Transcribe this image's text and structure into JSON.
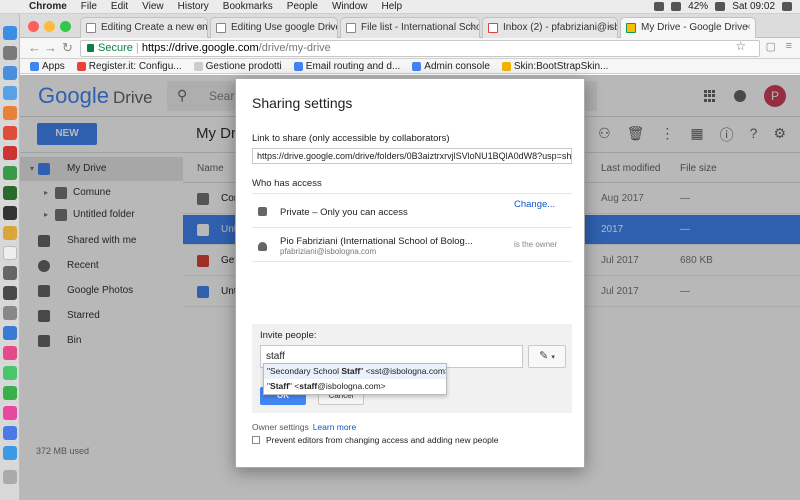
{
  "menubar": {
    "app": "Chrome",
    "items": [
      "File",
      "Edit",
      "View",
      "History",
      "Bookmarks",
      "People",
      "Window",
      "Help"
    ],
    "battery": "42%",
    "clock": "Sat 09:02"
  },
  "tabs": [
    {
      "title": "Editing Create a new one for"
    },
    {
      "title": "Editing Use google Drive for"
    },
    {
      "title": "File list - International School"
    },
    {
      "title": "Inbox (2) - pfabriziani@isbol"
    },
    {
      "title": "My Drive - Google Drive"
    }
  ],
  "omnibox": {
    "secure": "Secure",
    "url_host": "https://drive.google.com",
    "url_path": "/drive/my-drive"
  },
  "bookmarks": [
    {
      "label": "Apps",
      "color": "#4285f4"
    },
    {
      "label": "Register.it: Configu...",
      "color": "#ea4335"
    },
    {
      "label": "Gestione prodotti",
      "color": "#999999"
    },
    {
      "label": "Email routing and d...",
      "color": "#4285f4"
    },
    {
      "label": "Admin console",
      "color": "#4285f4"
    },
    {
      "label": "Skin:BootStrapSkin...",
      "color": "#f4b400"
    }
  ],
  "drive": {
    "logo": "Google",
    "logo_product": "Drive",
    "search_placeholder": "Search",
    "avatar_letter": "P",
    "new_button": "NEW",
    "title": "My Drive",
    "sidebar": [
      {
        "label": "My Drive"
      },
      {
        "label": "Comune"
      },
      {
        "label": "Untitled folder"
      },
      {
        "label": "Shared with me"
      },
      {
        "label": "Recent"
      },
      {
        "label": "Google Photos"
      },
      {
        "label": "Starred"
      },
      {
        "label": "Bin"
      }
    ],
    "usage": "372 MB used",
    "columns": {
      "name": "Name",
      "modified": "Last modified",
      "size": "File size"
    },
    "files": [
      {
        "name": "Comune",
        "modified": "Aug 2017",
        "size": "—",
        "color": "#757575"
      },
      {
        "name": "Untitled folder",
        "modified": "2017",
        "size": "—",
        "color": "#757575"
      },
      {
        "name": "Getting started",
        "modified": "Jul 2017",
        "size": "680 KB",
        "color": "#db4437"
      },
      {
        "name": "Untitled document",
        "modified": "Jul 2017",
        "size": "—",
        "color": "#4285f4"
      }
    ]
  },
  "dialog": {
    "title": "Sharing settings",
    "link_label": "Link to share (only accessible by collaborators)",
    "link_value": "https://drive.google.com/drive/folders/0B3aiztrxrvjlSVloNU1BQlA0dW8?usp=sharing",
    "who_label": "Who has access",
    "privacy": "Private – Only you can access",
    "change": "Change...",
    "owner_name": "Pio Fabriziani (International School of Bolog...",
    "owner_email": "pfabriziani@isbologna.com",
    "owner_role": "is the owner",
    "invite_label": "Invite people:",
    "invite_value": "staff",
    "suggestions": [
      {
        "pre": "\"Secondary School ",
        "bold": "Staff",
        "post": "\" <sst@isbologna.com>"
      },
      {
        "pre": "\"",
        "bold": "Staff",
        "post": "\" <",
        "bold2": "staff",
        "post2": "@isbologna.com>"
      }
    ],
    "ok": "OK",
    "cancel": "Cancel",
    "owner_settings": "Owner settings",
    "learn_more": "Learn more",
    "prevent_editors": "Prevent editors from changing access and adding new people"
  }
}
